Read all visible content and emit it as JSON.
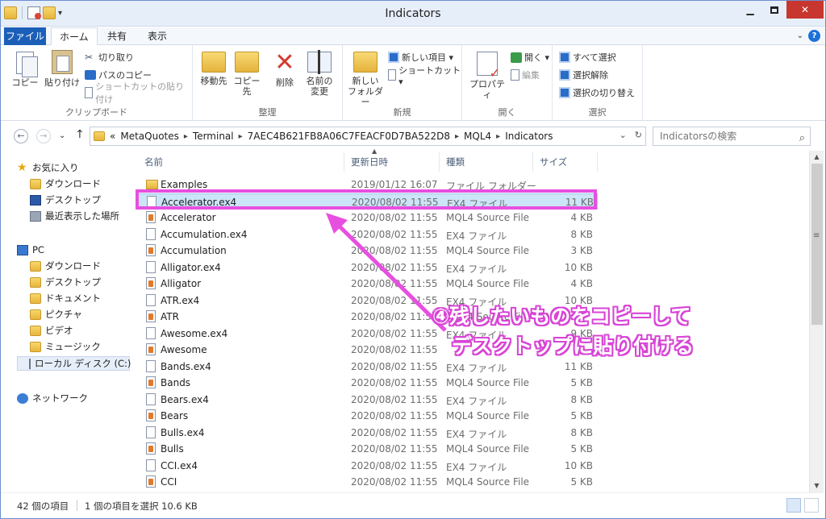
{
  "window": {
    "title": "Indicators"
  },
  "ribbon_tabs": [
    {
      "label": "ファイル"
    },
    {
      "label": "ホーム"
    },
    {
      "label": "共有"
    },
    {
      "label": "表示"
    }
  ],
  "ribbon": {
    "clipboard": {
      "copy": "コピー",
      "paste": "貼り付け",
      "cut": "切り取り",
      "copy_path": "パスのコピー",
      "paste_shortcut": "ショートカットの貼り付け",
      "label": "クリップボード"
    },
    "organize": {
      "move_to": "移動先",
      "copy_to": "コピー先",
      "delete": "削除",
      "rename_l1": "名前の",
      "rename_l2": "変更",
      "label": "整理"
    },
    "new": {
      "new_folder_l1": "新しい",
      "new_folder_l2": "フォルダー",
      "new_item": "新しい項目 ▾",
      "shortcut": "ショートカット ▾",
      "label": "新規"
    },
    "open": {
      "properties": "プロパティ",
      "open": "開く ▾",
      "edit": "編集",
      "label": "開く"
    },
    "select": {
      "select_all": "すべて選択",
      "select_none": "選択解除",
      "invert": "選択の切り替え",
      "label": "選択"
    }
  },
  "address": {
    "prefix": "«",
    "crumbs": [
      "MetaQuotes",
      "Terminal",
      "7AEC4B621FB8A06C7FEACF0D7BA522D8",
      "MQL4",
      "Indicators"
    ],
    "search_placeholder": "Indicatorsの検索"
  },
  "sidebar": {
    "favorites": {
      "label": "お気に入り",
      "items": [
        {
          "label": "ダウンロード"
        },
        {
          "label": "デスクトップ"
        },
        {
          "label": "最近表示した場所"
        }
      ]
    },
    "pc": {
      "label": "PC",
      "items": [
        {
          "label": "ダウンロード"
        },
        {
          "label": "デスクトップ"
        },
        {
          "label": "ドキュメント"
        },
        {
          "label": "ピクチャ"
        },
        {
          "label": "ビデオ"
        },
        {
          "label": "ミュージック"
        },
        {
          "label": "ローカル ディスク (C:)"
        }
      ]
    },
    "network": {
      "label": "ネットワーク"
    }
  },
  "columns": {
    "name": "名前",
    "date": "更新日時",
    "type": "種類",
    "size": "サイズ"
  },
  "files": [
    {
      "name": "Examples",
      "date": "2019/01/12 16:07",
      "type": "ファイル フォルダー",
      "size": "",
      "icon": "folder-icon"
    },
    {
      "name": "Accelerator.ex4",
      "date": "2020/08/02 11:55",
      "type": "EX4 ファイル",
      "size": "11 KB",
      "icon": "file-icon"
    },
    {
      "name": "Accelerator",
      "date": "2020/08/02 11:55",
      "type": "MQL4 Source File",
      "size": "4 KB",
      "icon": "mql-file-icon"
    },
    {
      "name": "Accumulation.ex4",
      "date": "2020/08/02 11:55",
      "type": "EX4 ファイル",
      "size": "8 KB",
      "icon": "file-icon"
    },
    {
      "name": "Accumulation",
      "date": "2020/08/02 11:55",
      "type": "MQL4 Source File",
      "size": "3 KB",
      "icon": "mql-file-icon"
    },
    {
      "name": "Alligator.ex4",
      "date": "2020/08/02 11:55",
      "type": "EX4 ファイル",
      "size": "10 KB",
      "icon": "file-icon"
    },
    {
      "name": "Alligator",
      "date": "2020/08/02 11:55",
      "type": "MQL4 Source File",
      "size": "4 KB",
      "icon": "mql-file-icon"
    },
    {
      "name": "ATR.ex4",
      "date": "2020/08/02 11:55",
      "type": "EX4 ファイル",
      "size": "10 KB",
      "icon": "file-icon"
    },
    {
      "name": "ATR",
      "date": "2020/08/02 11:55",
      "type": "MQL4 Source File",
      "size": "",
      "icon": "mql-file-icon"
    },
    {
      "name": "Awesome.ex4",
      "date": "2020/08/02 11:55",
      "type": "EX4 ファイル",
      "size": "9 KB",
      "icon": "file-icon"
    },
    {
      "name": "Awesome",
      "date": "2020/08/02 11:55",
      "type": "",
      "size": "",
      "icon": "mql-file-icon"
    },
    {
      "name": "Bands.ex4",
      "date": "2020/08/02 11:55",
      "type": "EX4 ファイル",
      "size": "11 KB",
      "icon": "file-icon"
    },
    {
      "name": "Bands",
      "date": "2020/08/02 11:55",
      "type": "MQL4 Source File",
      "size": "5 KB",
      "icon": "mql-file-icon"
    },
    {
      "name": "Bears.ex4",
      "date": "2020/08/02 11:55",
      "type": "EX4 ファイル",
      "size": "8 KB",
      "icon": "file-icon"
    },
    {
      "name": "Bears",
      "date": "2020/08/02 11:55",
      "type": "MQL4 Source File",
      "size": "5 KB",
      "icon": "mql-file-icon"
    },
    {
      "name": "Bulls.ex4",
      "date": "2020/08/02 11:55",
      "type": "EX4 ファイル",
      "size": "8 KB",
      "icon": "file-icon"
    },
    {
      "name": "Bulls",
      "date": "2020/08/02 11:55",
      "type": "MQL4 Source File",
      "size": "5 KB",
      "icon": "mql-file-icon"
    },
    {
      "name": "CCI.ex4",
      "date": "2020/08/02 11:55",
      "type": "EX4 ファイル",
      "size": "10 KB",
      "icon": "file-icon"
    },
    {
      "name": "CCI",
      "date": "2020/08/02 11:55",
      "type": "MQL4 Source File",
      "size": "5 KB",
      "icon": "mql-file-icon"
    }
  ],
  "status": {
    "count": "42 個の項目",
    "selection": "1 個の項目を選択  10.6 KB"
  },
  "annotation": {
    "line1": "④残したいものをコピーして",
    "line2": "デスクトップに貼り付ける",
    "color": "#e74fe0"
  }
}
